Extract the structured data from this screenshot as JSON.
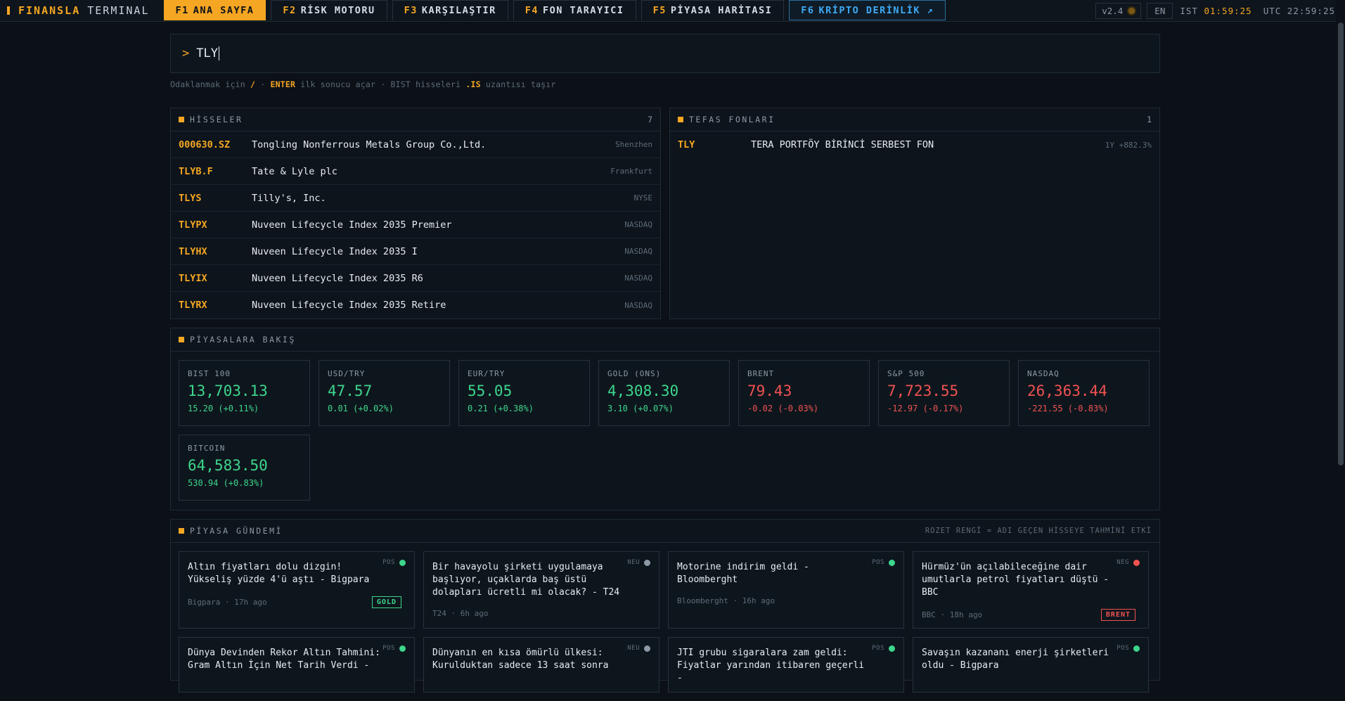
{
  "brand": {
    "name1": "FINANSLA",
    "name2": "TERMINAL"
  },
  "tabs": [
    {
      "key": "F1",
      "label": "ANA SAYFA"
    },
    {
      "key": "F2",
      "label": "RİSK MOTORU"
    },
    {
      "key": "F3",
      "label": "KARŞILAŞTIR"
    },
    {
      "key": "F4",
      "label": "FON TARAYICI"
    },
    {
      "key": "F5",
      "label": "PİYASA HARİTASI"
    },
    {
      "key": "F6",
      "label": "KRİPTO DERİNLİK ↗"
    }
  ],
  "status": {
    "version": "v2.4",
    "lang": "EN",
    "ist_label": "IST",
    "ist_time": "01:59:25",
    "utc": "UTC 22:59:25"
  },
  "search": {
    "prompt": ">",
    "value": "TLY"
  },
  "hint": {
    "p1": "Odaklanmak için",
    "k1": "/",
    "p2": "·",
    "k2": "ENTER",
    "p3": "ilk sonucu açar · BIST hisseleri",
    "k3": ".IS",
    "p4": "uzantısı taşır"
  },
  "stocks": {
    "title": "HİSSELER",
    "count": "7",
    "rows": [
      {
        "sym": "000630.SZ",
        "name": "Tongling Nonferrous Metals Group Co.,Ltd.",
        "ex": "Shenzhen"
      },
      {
        "sym": "TLYB.F",
        "name": "Tate & Lyle plc",
        "ex": "Frankfurt"
      },
      {
        "sym": "TLYS",
        "name": "Tilly's, Inc.",
        "ex": "NYSE"
      },
      {
        "sym": "TLYPX",
        "name": "Nuveen Lifecycle Index 2035 Premier",
        "ex": "NASDAQ"
      },
      {
        "sym": "TLYHX",
        "name": "Nuveen Lifecycle Index 2035 I",
        "ex": "NASDAQ"
      },
      {
        "sym": "TLYIX",
        "name": "Nuveen Lifecycle Index 2035 R6",
        "ex": "NASDAQ"
      },
      {
        "sym": "TLYRX",
        "name": "Nuveen Lifecycle Index 2035 Retire",
        "ex": "NASDAQ"
      }
    ]
  },
  "funds": {
    "title": "TEFAS FONLARI",
    "count": "1",
    "rows": [
      {
        "sym": "TLY",
        "name": "TERA PORTFÖY BİRİNCİ SERBEST FON",
        "ex": "1Y +882.3%"
      }
    ]
  },
  "overview": {
    "title": "PİYASALARA BAKIŞ",
    "colors": {
      "up": "#3dd68c",
      "down": "#f05252"
    },
    "cards": [
      {
        "label": "BIST 100",
        "value": "13,703.13",
        "change": "15.20 (+0.11%)",
        "dir": "up"
      },
      {
        "label": "USD/TRY",
        "value": "47.57",
        "change": "0.01 (+0.02%)",
        "dir": "up"
      },
      {
        "label": "EUR/TRY",
        "value": "55.05",
        "change": "0.21 (+0.38%)",
        "dir": "up"
      },
      {
        "label": "GOLD (ONS)",
        "value": "4,308.30",
        "change": "3.10 (+0.07%)",
        "dir": "up"
      },
      {
        "label": "BRENT",
        "value": "79.43",
        "change": "-0.02 (-0.03%)",
        "dir": "dn"
      },
      {
        "label": "S&P 500",
        "value": "7,723.55",
        "change": "-12.97 (-0.17%)",
        "dir": "dn"
      },
      {
        "label": "NASDAQ",
        "value": "26,363.44",
        "change": "-221.55 (-0.83%)",
        "dir": "dn"
      },
      {
        "label": "BITCOIN",
        "value": "64,583.50",
        "change": "530.94 (+0.83%)",
        "dir": "up"
      }
    ]
  },
  "news": {
    "title": "PİYASA GÜNDEMİ",
    "note": "ROZET RENGİ = ADI GEÇEN HİSSEYE TAHMİNİ ETKİ",
    "items": [
      {
        "title": "Altın fiyatları dolu dizgin! Yükseliş yüzde 4'ü aştı - Bigpara",
        "meta": "Bigpara · 17h ago",
        "sent": "POS",
        "tag": "GOLD",
        "tagc": "g"
      },
      {
        "title": "Bir havayolu şirketi uygulamaya başlıyor, uçaklarda baş üstü dolapları ücretli mi olacak? - T24",
        "meta": "T24 · 6h ago",
        "sent": "NEU",
        "tag": "",
        "tagc": ""
      },
      {
        "title": "Motorine indirim geldi - Bloomberght",
        "meta": "Bloomberght · 16h ago",
        "sent": "POS",
        "tag": "",
        "tagc": ""
      },
      {
        "title": "Hürmüz'ün açılabileceğine dair umutlarla petrol fiyatları düştü - BBC",
        "meta": "BBC · 18h ago",
        "sent": "NEG",
        "tag": "BRENT",
        "tagc": "r"
      },
      {
        "title": "Dünya Devinden Rekor Altın Tahmini: Gram Altın İçin Net Tarih Verdi -",
        "meta": "",
        "sent": "POS",
        "tag": "",
        "tagc": ""
      },
      {
        "title": "Dünyanın en kısa ömürlü ülkesi: Kurulduktan sadece 13 saat sonra",
        "meta": "",
        "sent": "NEU",
        "tag": "",
        "tagc": ""
      },
      {
        "title": "JTI grubu sigaralara zam geldi: Fiyatlar yarından itibaren geçerli -",
        "meta": "",
        "sent": "POS",
        "tag": "",
        "tagc": ""
      },
      {
        "title": "Savaşın kazananı enerji şirketleri oldu - Bigpara",
        "meta": "",
        "sent": "POS",
        "tag": "",
        "tagc": ""
      }
    ]
  }
}
